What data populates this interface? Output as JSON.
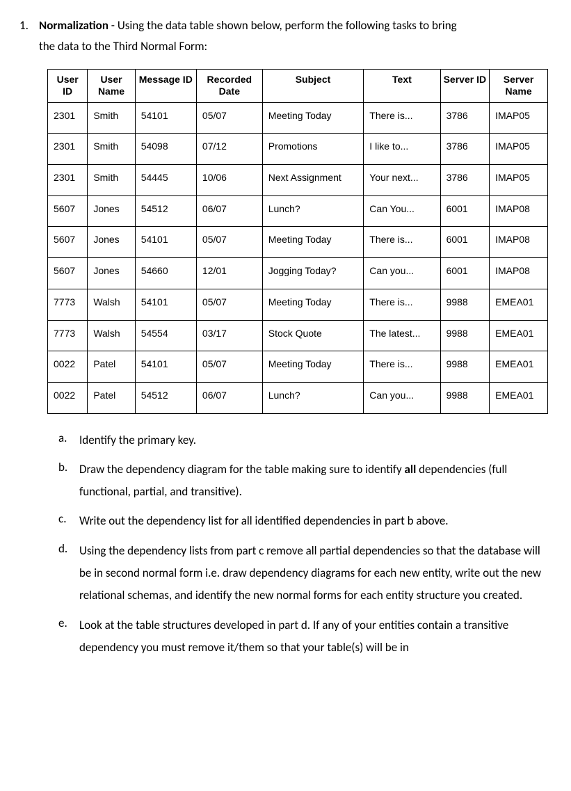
{
  "question": {
    "number": "1.",
    "title": "Normalization",
    "sep": " - ",
    "intro1": "Using the data table shown below, perform the following tasks to bring",
    "intro2": "the data to the Third Normal Form:"
  },
  "table": {
    "headers": {
      "user_id": "User ID",
      "user_name": "User Name",
      "message_id": "Message ID",
      "recorded_date": "Recorded Date",
      "subject": "Subject",
      "text": "Text",
      "server_id": "Server ID",
      "server_name": "Server Name"
    },
    "rows": [
      {
        "user_id": "2301",
        "user_name": "Smith",
        "message_id": "54101",
        "recorded_date": "05/07",
        "subject": "Meeting Today",
        "text": "There is...",
        "server_id": "3786",
        "server_name": "IMAP05"
      },
      {
        "user_id": "2301",
        "user_name": "Smith",
        "message_id": "54098",
        "recorded_date": "07/12",
        "subject": "Promotions",
        "text": "I like to...",
        "server_id": "3786",
        "server_name": "IMAP05"
      },
      {
        "user_id": "2301",
        "user_name": "Smith",
        "message_id": "54445",
        "recorded_date": "10/06",
        "subject": "Next Assignment",
        "text": "Your next...",
        "server_id": "3786",
        "server_name": "IMAP05"
      },
      {
        "user_id": "5607",
        "user_name": "Jones",
        "message_id": "54512",
        "recorded_date": "06/07",
        "subject": "Lunch?",
        "text": "Can You...",
        "server_id": "6001",
        "server_name": "IMAP08"
      },
      {
        "user_id": "5607",
        "user_name": "Jones",
        "message_id": "54101",
        "recorded_date": "05/07",
        "subject": "Meeting Today",
        "text": "There is...",
        "server_id": "6001",
        "server_name": "IMAP08"
      },
      {
        "user_id": "5607",
        "user_name": "Jones",
        "message_id": "54660",
        "recorded_date": "12/01",
        "subject": "Jogging Today?",
        "text": "Can you...",
        "server_id": "6001",
        "server_name": "IMAP08"
      },
      {
        "user_id": "7773",
        "user_name": "Walsh",
        "message_id": "54101",
        "recorded_date": "05/07",
        "subject": "Meeting Today",
        "text": "There is...",
        "server_id": "9988",
        "server_name": "EMEA01"
      },
      {
        "user_id": "7773",
        "user_name": "Walsh",
        "message_id": "54554",
        "recorded_date": "03/17",
        "subject": "Stock Quote",
        "text": "The latest...",
        "server_id": "9988",
        "server_name": "EMEA01"
      },
      {
        "user_id": "0022",
        "user_name": "Patel",
        "message_id": "54101",
        "recorded_date": "05/07",
        "subject": "Meeting Today",
        "text": "There is...",
        "server_id": "9988",
        "server_name": "EMEA01"
      },
      {
        "user_id": "0022",
        "user_name": "Patel",
        "message_id": "54512",
        "recorded_date": "06/07",
        "subject": "Lunch?",
        "text": "Can you...",
        "server_id": "9988",
        "server_name": "EMEA01"
      }
    ]
  },
  "subs": {
    "a": {
      "letter": "a.",
      "text": "Identify the primary key."
    },
    "b": {
      "letter": "b.",
      "pre": "Draw the dependency diagram for the table making sure to identify ",
      "bold": "all",
      "post": " dependencies (full functional, partial, and transitive)."
    },
    "c": {
      "letter": "c.",
      "text": "Write out the dependency list for all identified dependencies in part b above."
    },
    "d": {
      "letter": "d.",
      "text": "Using the dependency lists from part c remove all partial dependencies so that the database will be in second normal form i.e. draw dependency diagrams for each new entity, write out the new relational schemas, and identify the new normal forms for each entity structure you created."
    },
    "e": {
      "letter": "e.",
      "text": "Look at the table structures developed in part d.  If any of your entities contain a transitive dependency you must remove it/them so that your table(s) will be in"
    }
  }
}
